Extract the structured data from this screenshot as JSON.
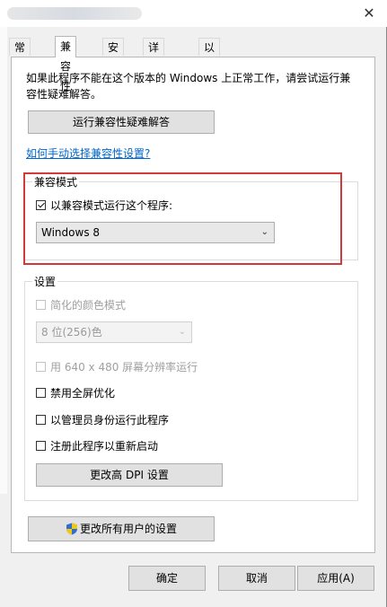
{
  "window": {
    "close_glyph": "✕"
  },
  "tabs": [
    {
      "label": "常规",
      "active": false
    },
    {
      "label": "兼容性",
      "active": true
    },
    {
      "label": "安全",
      "active": false
    },
    {
      "label": "详细信息",
      "active": false
    },
    {
      "label": "以前的版本",
      "active": false
    }
  ],
  "panel": {
    "description": "如果此程序不能在这个版本的 Windows 上正常工作，请尝试运行兼容性疑难解答。",
    "troubleshoot_button": "运行兼容性疑难解答",
    "manual_link": "如何手动选择兼容性设置?"
  },
  "compat_mode": {
    "group_label": "兼容模式",
    "checkbox_label": "以兼容模式运行这个程序:",
    "checked": true,
    "selected_os": "Windows 8",
    "highlight_color": "#d23a3a"
  },
  "settings": {
    "group_label": "设置",
    "reduced_color": {
      "label": "简化的颜色模式",
      "checked": false,
      "enabled": false
    },
    "color_depth": {
      "value": "8 位(256)色",
      "enabled": false
    },
    "res_640": {
      "label": "用 640 x 480 屏幕分辨率运行",
      "checked": false,
      "enabled": false
    },
    "disable_fullscreen": {
      "label": "禁用全屏优化",
      "checked": false
    },
    "run_as_admin": {
      "label": "以管理员身份运行此程序",
      "checked": false
    },
    "register_restart": {
      "label": "注册此程序以重新启动",
      "checked": false
    },
    "dpi_button": "更改高 DPI 设置"
  },
  "all_users_button": "更改所有用户的设置",
  "footer": {
    "ok": "确定",
    "cancel": "取消",
    "apply": "应用(A)"
  },
  "icons": {
    "shield": "uac-shield-icon",
    "dropdown": "chevron-down-icon"
  }
}
